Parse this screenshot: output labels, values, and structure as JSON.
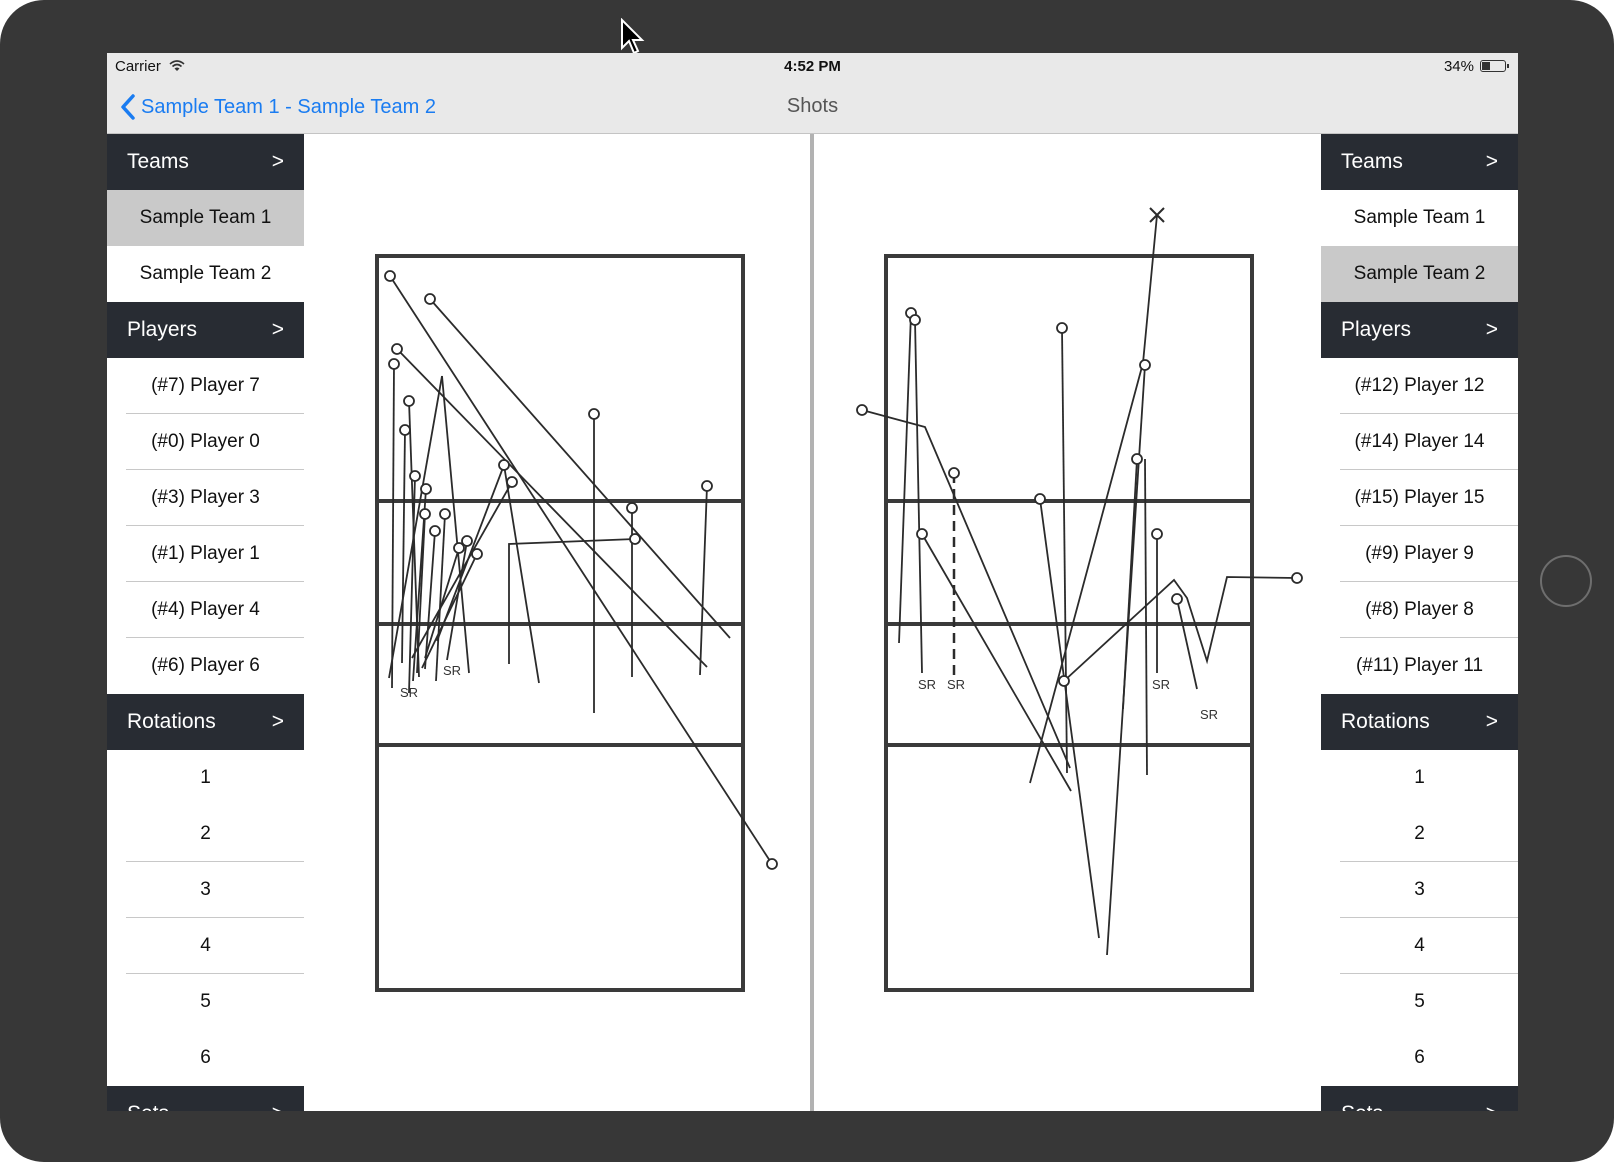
{
  "status_bar": {
    "carrier": "Carrier",
    "time": "4:52 PM",
    "battery": "34%"
  },
  "nav": {
    "back_label": "Sample Team 1 - Sample Team 2",
    "title": "Shots"
  },
  "left_panel": {
    "teams_header": "Teams",
    "players_header": "Players",
    "rotations_header": "Rotations",
    "sets_header": "Sets",
    "chevron": ">",
    "teams": [
      "Sample Team 1",
      "Sample Team 2"
    ],
    "selected_team": "Sample Team 1",
    "players": [
      "(#7) Player 7",
      "(#0) Player 0",
      "(#3) Player 3",
      "(#1) Player 1",
      "(#4) Player 4",
      "(#6) Player 6"
    ],
    "rotations": [
      "1",
      "2",
      "3",
      "4",
      "5",
      "6"
    ]
  },
  "right_panel": {
    "teams_header": "Teams",
    "players_header": "Players",
    "rotations_header": "Rotations",
    "sets_header": "Sets",
    "chevron": ">",
    "teams": [
      "Sample Team 1",
      "Sample Team 2"
    ],
    "selected_team": "Sample Team 2",
    "players": [
      "(#12) Player 12",
      "(#14) Player 14",
      "(#15) Player 15",
      "(#9) Player 9",
      "(#8) Player 8",
      "(#11) Player 11"
    ],
    "rotations": [
      "1",
      "2",
      "3",
      "4",
      "5",
      "6"
    ]
  },
  "court_labels": {
    "serve_receive": "SR"
  },
  "icons": {
    "back": "chevron-left-icon",
    "wifi": "wifi-icon",
    "battery": "battery-icon",
    "shot_start": "circle-marker",
    "shot_error": "x-marker",
    "home": "home-button",
    "cursor": "cursor-arrow-icon"
  },
  "colors": {
    "tint": "#1a7cf1",
    "header_bg": "#282c33",
    "selected_bg": "#c9c9c9",
    "bezel": "#373737",
    "court_line": "#3a3a3a"
  }
}
